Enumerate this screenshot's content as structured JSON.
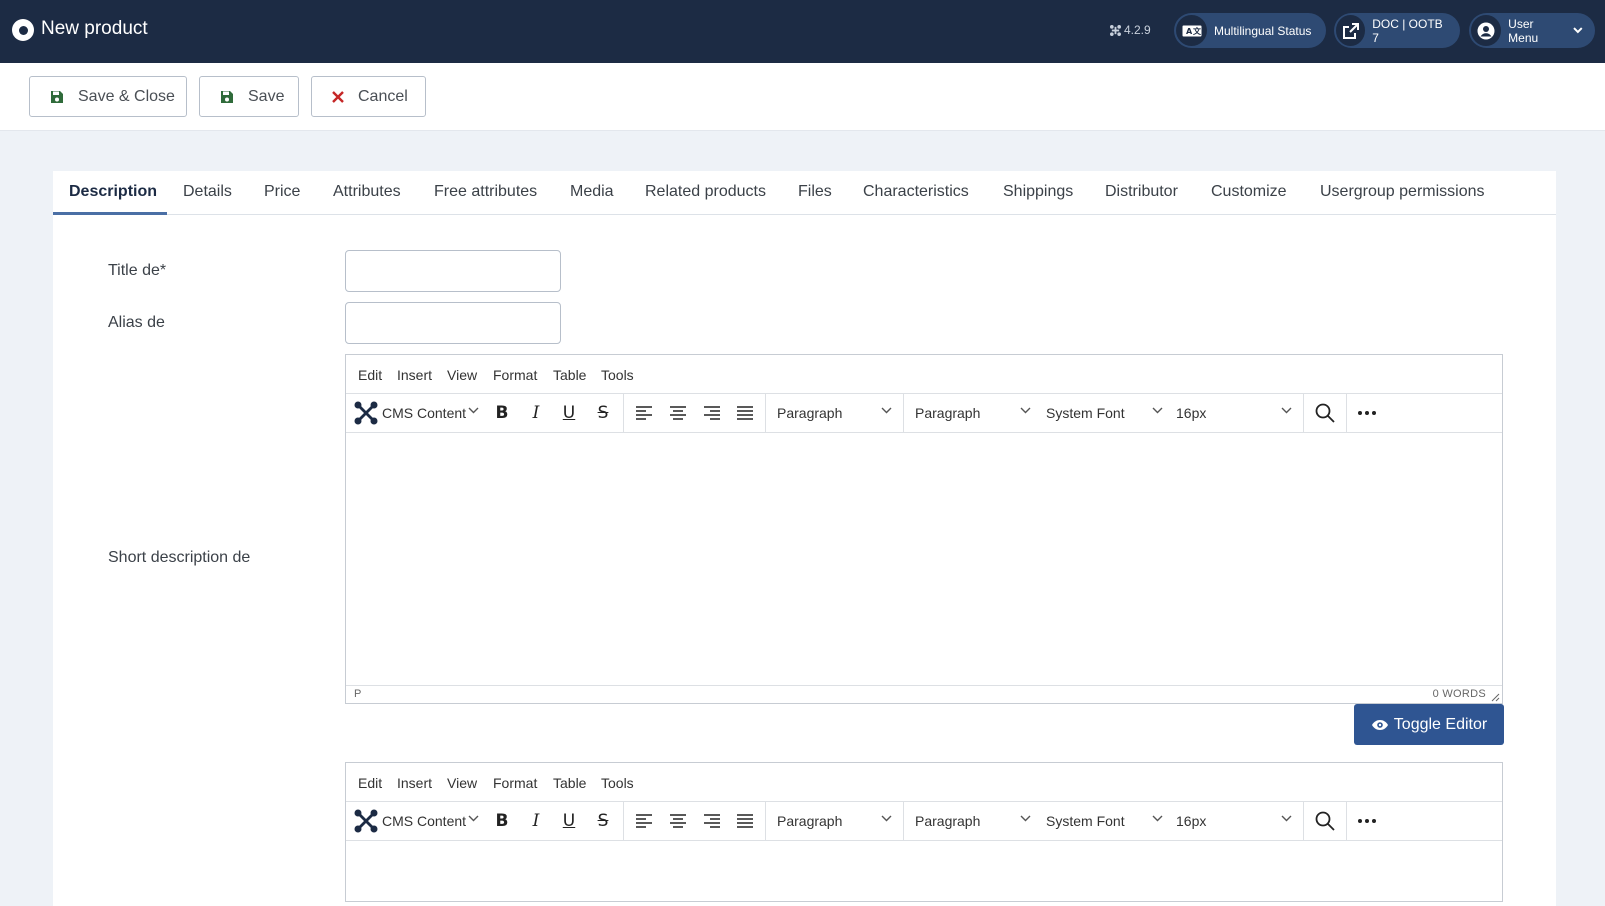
{
  "header": {
    "title": "New product",
    "version": "4.2.9",
    "multilingual_label": "Multilingual Status",
    "doc_label": "DOC | OOTB 7",
    "user_menu_label": "User Menu"
  },
  "toolbar": {
    "save_close_label": "Save & Close",
    "save_label": "Save",
    "cancel_label": "Cancel"
  },
  "tabs": [
    {
      "label": "Description",
      "active": true
    },
    {
      "label": "Details"
    },
    {
      "label": "Price"
    },
    {
      "label": "Attributes"
    },
    {
      "label": "Free attributes"
    },
    {
      "label": "Media"
    },
    {
      "label": "Related products"
    },
    {
      "label": "Files"
    },
    {
      "label": "Characteristics"
    },
    {
      "label": "Shippings"
    },
    {
      "label": "Distributor"
    },
    {
      "label": "Customize"
    },
    {
      "label": "Usergroup permissions"
    }
  ],
  "form": {
    "title_label": "Title de*",
    "title_value": "",
    "alias_label": "Alias de",
    "alias_value": "",
    "short_desc_label": "Short description de"
  },
  "editor": {
    "menu": [
      "Edit",
      "Insert",
      "View",
      "Format",
      "Table",
      "Tools"
    ],
    "cms_content_label": "CMS Content",
    "block_format": "Paragraph",
    "style_format": "Paragraph",
    "font_family": "System Font",
    "font_size": "16px",
    "status_path": "P",
    "word_count": "0 WORDS"
  },
  "toggle_editor_label": "Toggle Editor",
  "colors": {
    "header_bg": "#1c2b44",
    "pill_bg": "#2e4a73",
    "toggle_bg": "#2f5592",
    "save_icon": "#2f6b3a",
    "cancel_icon": "#c52727"
  }
}
